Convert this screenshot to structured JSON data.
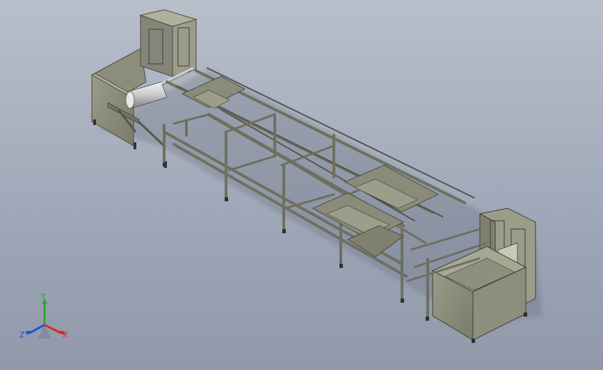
{
  "view": {
    "background_top": "#b7bfcb",
    "background_bottom": "#9098aa"
  },
  "model": {
    "frame_color": "#6e6f5f",
    "panel_color": "#8b8c7a",
    "shadow_color": "#5a5b4d"
  },
  "triad": {
    "x_label": "X",
    "y_label": "Y",
    "z_label": "Z",
    "x_color": "#d42a2a",
    "y_color": "#2aa82a",
    "z_color": "#2a4ed4"
  }
}
